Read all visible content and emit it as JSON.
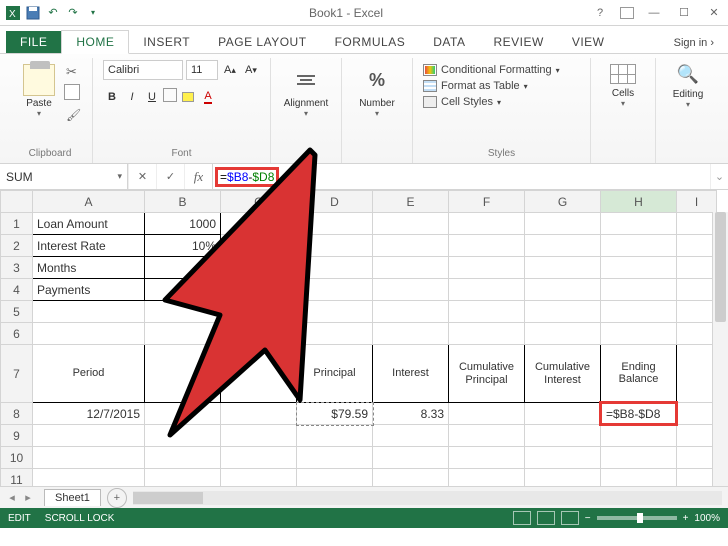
{
  "title": "Book1 - Excel",
  "tabs": {
    "file": "FILE",
    "home": "HOME",
    "insert": "INSERT",
    "pagelayout": "PAGE LAYOUT",
    "formulas": "FORMULAS",
    "data": "DATA",
    "review": "REVIEW",
    "view": "VIEW",
    "signin": "Sign in"
  },
  "ribbon": {
    "paste": "Paste",
    "clipboard": "Clipboard",
    "font_name": "Calibri",
    "font_size": "11",
    "font": "Font",
    "alignment": "Alignment",
    "number": "Number",
    "cond_fmt": "Conditional Formatting",
    "fmt_table": "Format as Table",
    "cell_styles": "Cell Styles",
    "styles": "Styles",
    "cells": "Cells",
    "editing": "Editing"
  },
  "formula_bar": {
    "name_box": "SUM",
    "formula_prefix": "=",
    "ref1": "$B8",
    "op": "-",
    "ref2": "$D8"
  },
  "columns": [
    "A",
    "B",
    "C",
    "D",
    "E",
    "F",
    "G",
    "H",
    "I"
  ],
  "rows": {
    "r1": {
      "A": "Loan Amount",
      "B": "1000"
    },
    "r2": {
      "A": "Interest Rate",
      "B": "10%"
    },
    "r3": {
      "A": "Months"
    },
    "r4": {
      "A": "Payments"
    },
    "r7": {
      "A": "Period",
      "D": "Principal",
      "E": "Interest",
      "F": "Cumulative Principal",
      "G": "Cumulative Interest",
      "H": "Ending Balance"
    },
    "r8": {
      "A": "12/7/2015",
      "D": "$79.59",
      "E": "8.33",
      "H": "=$B8-$D8"
    }
  },
  "sheet_tab": "Sheet1",
  "status": {
    "edit": "EDIT",
    "scroll": "SCROLL LOCK",
    "zoom": "100%"
  }
}
